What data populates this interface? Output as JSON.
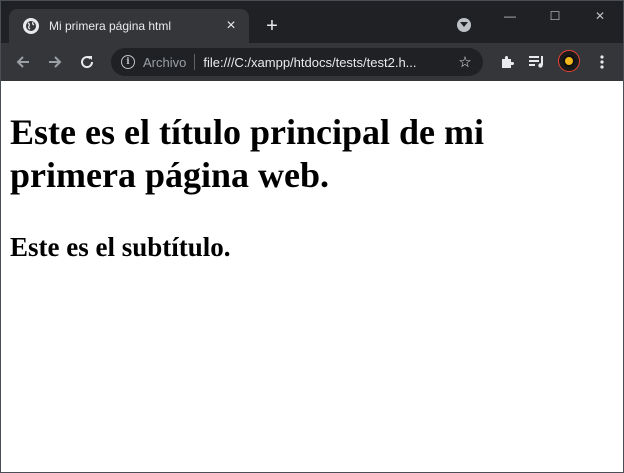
{
  "browser": {
    "tab": {
      "title": "Mi primera página html",
      "close_glyph": "×"
    },
    "new_tab_glyph": "+",
    "window_controls": {
      "minimize": "—",
      "maximize": "☐",
      "close": "✕"
    },
    "address_bar": {
      "scheme_label": "Archivo",
      "url": "file:///C:/xampp/htdocs/tests/test2.h..."
    },
    "icons": {
      "favicon": "globe-icon",
      "back": "arrow-left-icon",
      "forward": "arrow-right-icon",
      "reload": "reload-icon",
      "info": "info-icon",
      "bookmark": "star-icon",
      "extensions": "puzzle-icon",
      "media": "playlist-icon",
      "menu": "kebab-menu-icon",
      "tab_search": "tab-search-icon"
    },
    "colors": {
      "titlebar": "#202124",
      "toolbar": "#35363a",
      "text": "#e8eaed"
    }
  },
  "page": {
    "heading": "Este es el título principal de mi primera página web.",
    "subheading": "Este es el subtítulo."
  }
}
